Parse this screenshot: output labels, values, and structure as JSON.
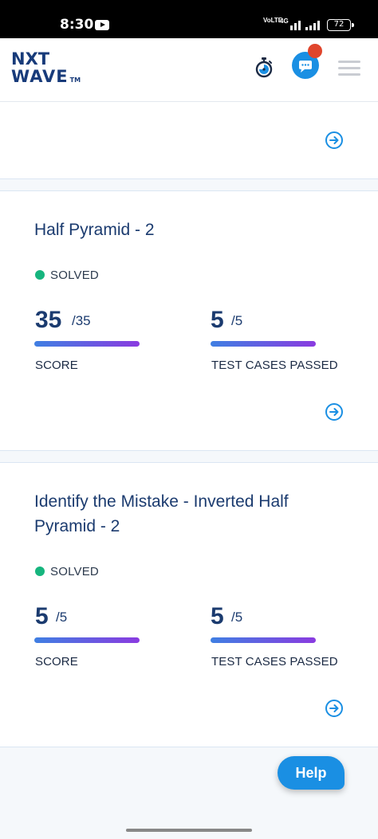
{
  "status_bar": {
    "time": "8:30",
    "network_label": "VoLTE",
    "network_type": "4G",
    "battery": "72"
  },
  "header": {
    "logo_line1": "NXT",
    "logo_line2": "WAVE",
    "logo_tm": "TM",
    "icons": [
      "stopwatch-icon",
      "chat-icon",
      "menu-icon"
    ],
    "accent_color": "#1a8fe3",
    "badge_color": "#e0452c"
  },
  "cards": [
    {
      "title": "Half Pyramid - 2",
      "status": "SOLVED",
      "score_value": "35",
      "score_total": "/35",
      "score_label": "SCORE",
      "tests_value": "5",
      "tests_total": "/5",
      "tests_label": "TEST CASES PASSED"
    },
    {
      "title": "Identify the Mistake - Inverted Half Pyramid - 2",
      "status": "SOLVED",
      "score_value": "5",
      "score_total": "/5",
      "score_label": "SCORE",
      "tests_value": "5",
      "tests_total": "/5",
      "tests_label": "TEST CASES PASSED"
    }
  ],
  "help_button": "Help",
  "colors": {
    "solved": "#16b57e",
    "title": "#1b3b6f",
    "bar_start": "#3f7fe2",
    "bar_end": "#8a3be0"
  }
}
